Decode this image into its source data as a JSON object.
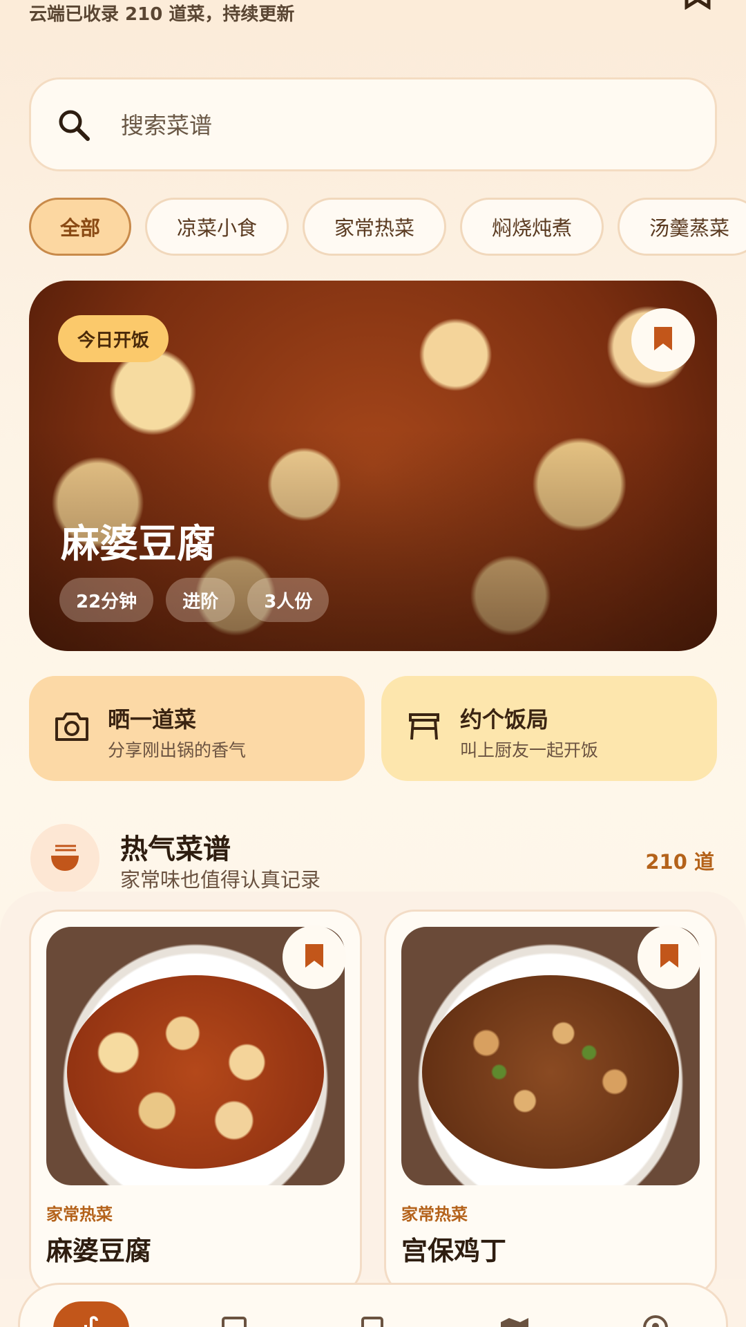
{
  "header": {
    "subtitle": "云端已收录 210 道菜，持续更新"
  },
  "search": {
    "placeholder": "搜索菜谱",
    "icon": "search-icon"
  },
  "categories": [
    {
      "label": "全部",
      "active": true
    },
    {
      "label": "凉菜小食",
      "active": false
    },
    {
      "label": "家常热菜",
      "active": false
    },
    {
      "label": "焖烧炖煮",
      "active": false
    },
    {
      "label": "汤羹蒸菜",
      "active": false
    }
  ],
  "hero": {
    "badge": "今日开饭",
    "title": "麻婆豆腐",
    "tags": [
      "22分钟",
      "进阶",
      "3人份"
    ]
  },
  "actions": [
    {
      "title": "晒一道菜",
      "desc": "分享刚出锅的香气",
      "icon": "camera-icon"
    },
    {
      "title": "约个饭局",
      "desc": "叫上厨友一起开饭",
      "icon": "table-icon"
    }
  ],
  "section": {
    "title": "热气菜谱",
    "subtitle": "家常味也值得认真记录",
    "count": "210 道",
    "icon": "noodle-bowl-icon"
  },
  "recipes": [
    {
      "category": "家常热菜",
      "name": "麻婆豆腐"
    },
    {
      "category": "家常热菜",
      "name": "宫保鸡丁"
    }
  ],
  "nav": {
    "items": [
      "home-icon",
      "book-icon",
      "bookmark-list-icon",
      "map-icon",
      "location-icon"
    ]
  },
  "colors": {
    "accent": "#c2561a",
    "chip_active_bg": "#fcd7a1",
    "badge": "#fbc96b",
    "background": "#fdf3e5"
  }
}
